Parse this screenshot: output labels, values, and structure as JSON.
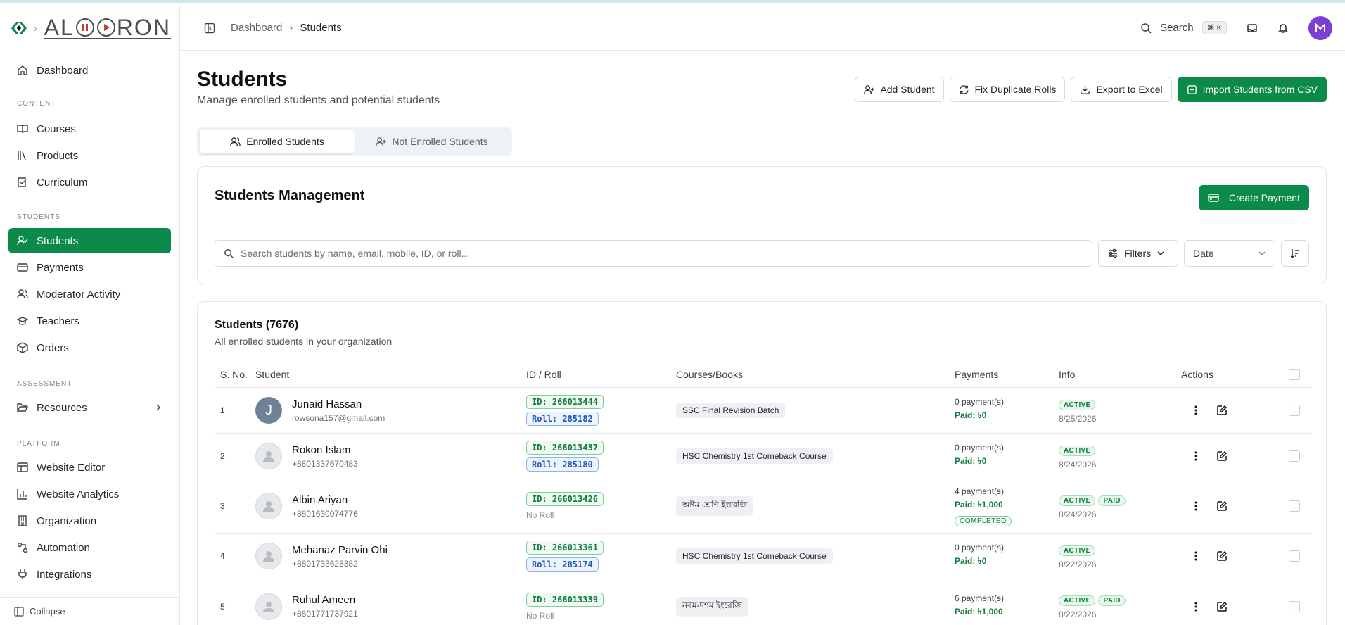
{
  "sidebar": {
    "brand": "ALORON",
    "items_top": [
      {
        "label": "Dashboard",
        "icon": "home-icon"
      }
    ],
    "sections": [
      {
        "label": "CONTENT",
        "items": [
          {
            "label": "Courses",
            "icon": "book-open-icon"
          },
          {
            "label": "Products",
            "icon": "library-icon"
          },
          {
            "label": "Curriculum",
            "icon": "book-check-icon"
          }
        ]
      },
      {
        "label": "STUDENTS",
        "items": [
          {
            "label": "Students",
            "icon": "user-check-icon",
            "active": true
          },
          {
            "label": "Payments",
            "icon": "wallet-icon"
          },
          {
            "label": "Moderator Activity",
            "icon": "users-icon"
          },
          {
            "label": "Teachers",
            "icon": "graduation-cap-icon"
          },
          {
            "label": "Orders",
            "icon": "package-icon"
          }
        ]
      },
      {
        "label": "ASSESSMENT",
        "items": [
          {
            "label": "Resources",
            "icon": "folder-open-icon"
          }
        ]
      },
      {
        "label": "PLATFORM",
        "items": [
          {
            "label": "Website Editor",
            "icon": "layout-icon"
          },
          {
            "label": "Website Analytics",
            "icon": "chart-icon"
          },
          {
            "label": "Organization",
            "icon": "building-icon"
          },
          {
            "label": "Automation",
            "icon": "workflow-icon"
          },
          {
            "label": "Integrations",
            "icon": "plug-icon"
          }
        ]
      }
    ],
    "collapse": "Collapse"
  },
  "header": {
    "crumb_root": "Dashboard",
    "crumb_current": "Students",
    "search_label": "Search",
    "search_kbd": "⌘ K"
  },
  "page": {
    "title": "Students",
    "subtitle": "Manage enrolled students and potential students",
    "actions": {
      "add": "Add Student",
      "fix": "Fix Duplicate Rolls",
      "export": "Export to Excel",
      "import": "Import Students from CSV"
    },
    "tabs": {
      "enrolled": "Enrolled Students",
      "not_enrolled": "Not Enrolled Students"
    }
  },
  "management": {
    "title": "Students Management",
    "create_payment": "Create Payment",
    "search_placeholder": "Search students by name, email, mobile, ID, or roll...",
    "filters": "Filters",
    "date": "Date"
  },
  "list": {
    "title": "Students (7676)",
    "subtitle": "All enrolled students in your organization",
    "columns": {
      "no": "S. No.",
      "student": "Student",
      "id": "ID / Roll",
      "courses": "Courses/Books",
      "payments": "Payments",
      "info": "Info",
      "actions": "Actions"
    },
    "rows": [
      {
        "no": "1",
        "initial": "J",
        "name": "Junaid Hassan",
        "contact": "rowsona157@gmail.com",
        "id": "ID: 266013444",
        "roll": "Roll: 285182",
        "course": "SSC Final Revision Batch",
        "payments": "0 payment(s)",
        "paid": "Paid: ৳0",
        "completed": "",
        "badges": [
          "ACTIVE"
        ],
        "date": "8/25/2026"
      },
      {
        "no": "2",
        "initial": "",
        "name": "Rokon Islam",
        "contact": "+8801337670483",
        "id": "ID: 266013437",
        "roll": "Roll: 285180",
        "course": "HSC Chemistry 1st Comeback Course",
        "payments": "0 payment(s)",
        "paid": "Paid: ৳0",
        "completed": "",
        "badges": [
          "ACTIVE"
        ],
        "date": "8/24/2026"
      },
      {
        "no": "3",
        "initial": "",
        "name": "Albin Ariyan",
        "contact": "+8801630074776",
        "id": "ID: 266013426",
        "roll": "",
        "no_roll": "No Roll",
        "course": "অষ্টম শ্রেণি ইংরেজি",
        "payments": "4 payment(s)",
        "paid": "Paid: ৳1,000",
        "completed": "COMPLETED",
        "badges": [
          "ACTIVE",
          "PAID"
        ],
        "date": "8/24/2026"
      },
      {
        "no": "4",
        "initial": "",
        "name": "Mehanaz Parvin Ohi",
        "contact": "+8801733628382",
        "id": "ID: 266013361",
        "roll": "Roll: 285174",
        "course": "HSC Chemistry 1st Comeback Course",
        "payments": "0 payment(s)",
        "paid": "Paid: ৳0",
        "completed": "",
        "badges": [
          "ACTIVE"
        ],
        "date": "8/22/2026"
      },
      {
        "no": "5",
        "initial": "",
        "name": "Ruhul Ameen",
        "contact": "+8801771737921",
        "id": "ID: 266013339",
        "roll": "",
        "no_roll": "No Roll",
        "course": "নবম-দশম ইংরেজি",
        "payments": "6 payment(s)",
        "paid": "Paid: ৳1,000",
        "completed": "",
        "badges": [
          "ACTIVE",
          "PAID"
        ],
        "date": "8/22/2026"
      }
    ]
  },
  "colors": {
    "brand_green": "#0b8a4a",
    "avatar_purple": "#7b3fd6"
  }
}
